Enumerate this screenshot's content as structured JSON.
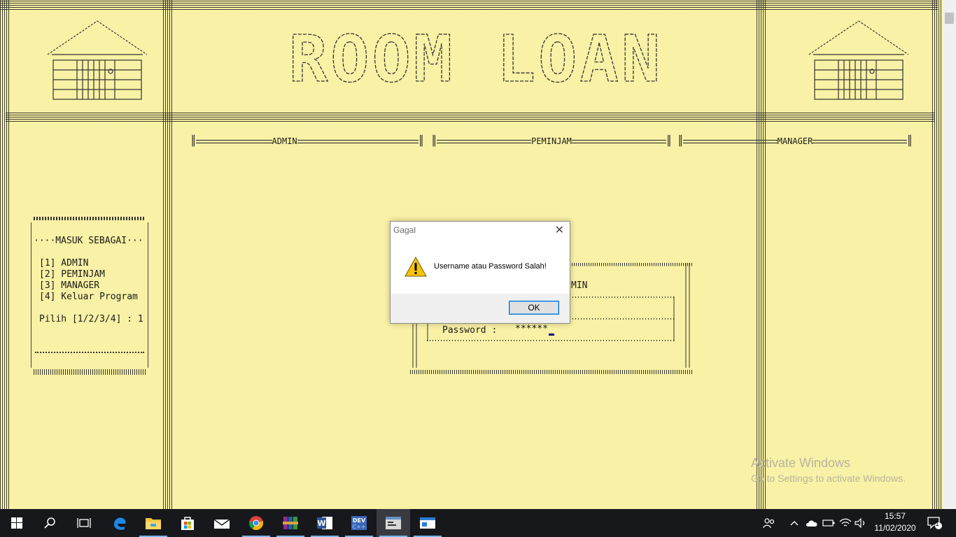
{
  "title_text": "ROOM LOAN",
  "menu": [
    {
      "label": "ADMIN"
    },
    {
      "label": "PEMINJAM"
    },
    {
      "label": "MANAGER"
    }
  ],
  "sidebar": {
    "heading": "····MASUK SEBAGAI···",
    "options": [
      "[1] ADMIN",
      "[2] PEMINJAM",
      "[3] MANAGER",
      "[4] Keluar Program"
    ],
    "prompt": "Pilih [1/2/3/4] : 1"
  },
  "login": {
    "header_partial": "MIN",
    "password_label": "Password :",
    "password_value": "******"
  },
  "dialog": {
    "title": "Gagal",
    "message": "Username atau Password Salah!",
    "ok_label": "OK"
  },
  "watermark": {
    "line1": "Activate Windows",
    "line2": "Go to Settings to activate Windows."
  },
  "taskbar": {
    "icons": [
      "windows-start-icon",
      "search-icon",
      "task-view-icon",
      "edge-icon",
      "file-explorer-icon",
      "store-icon",
      "mail-icon",
      "chrome-icon",
      "winrar-icon",
      "word-icon",
      "devcpp-icon",
      "console-app-icon",
      "app-window-icon"
    ],
    "time": "15:57",
    "date": "11/02/2020",
    "notification_count": "1"
  },
  "colors": {
    "background": "#f9f1a5",
    "taskbar": "#17181c",
    "dialog_accent": "#0078d7"
  }
}
